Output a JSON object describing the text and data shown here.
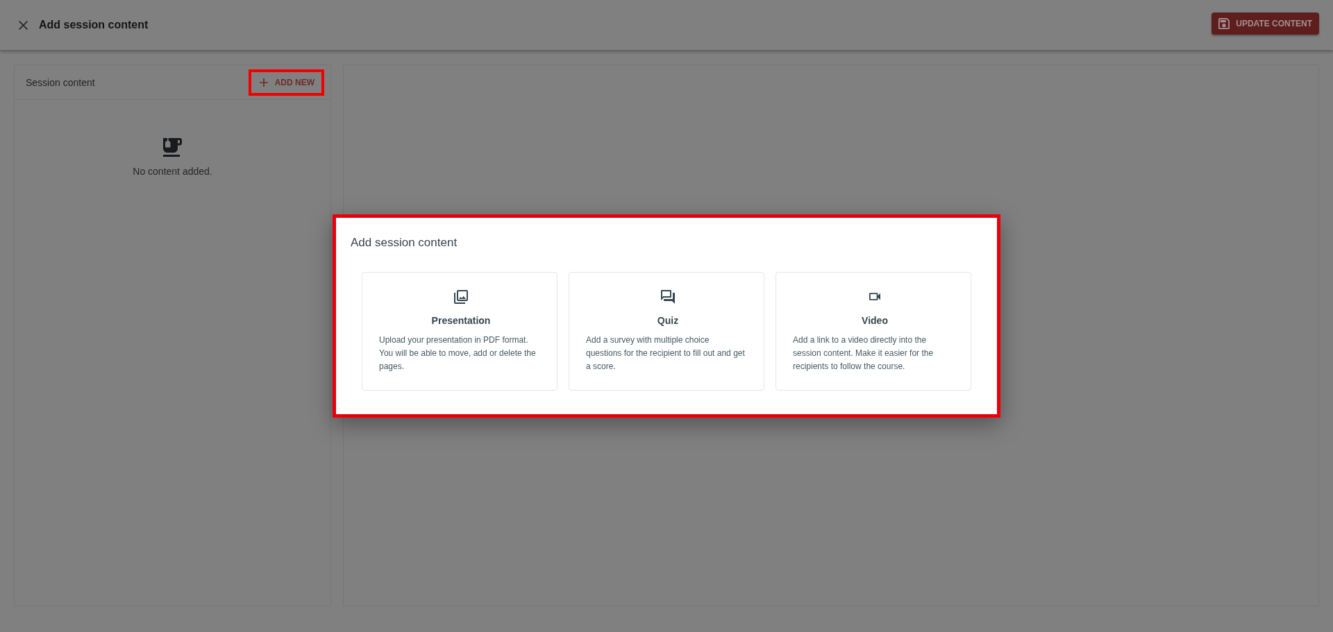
{
  "header": {
    "title": "Add session content",
    "update_button": {
      "label": "UPDATE CONTENT"
    }
  },
  "content_panel": {
    "title": "Session content",
    "add_button": {
      "label": "ADD NEW",
      "highlighted": true
    },
    "empty_message": "No content added."
  },
  "dialog": {
    "title": "Add session content",
    "highlighted": true,
    "options": [
      {
        "kind": "presentation",
        "title": "Presentation",
        "description": "Upload your presentation in PDF format. You will be able to move, add or delete the pages."
      },
      {
        "kind": "quiz",
        "title": "Quiz",
        "description": "Add a survey with multiple choice questions for the recipient to fill out and get a score."
      },
      {
        "kind": "video",
        "title": "Video",
        "description": "Add a link to a video directly into the session content. Make it easier for the recipients to follow the course."
      }
    ]
  }
}
